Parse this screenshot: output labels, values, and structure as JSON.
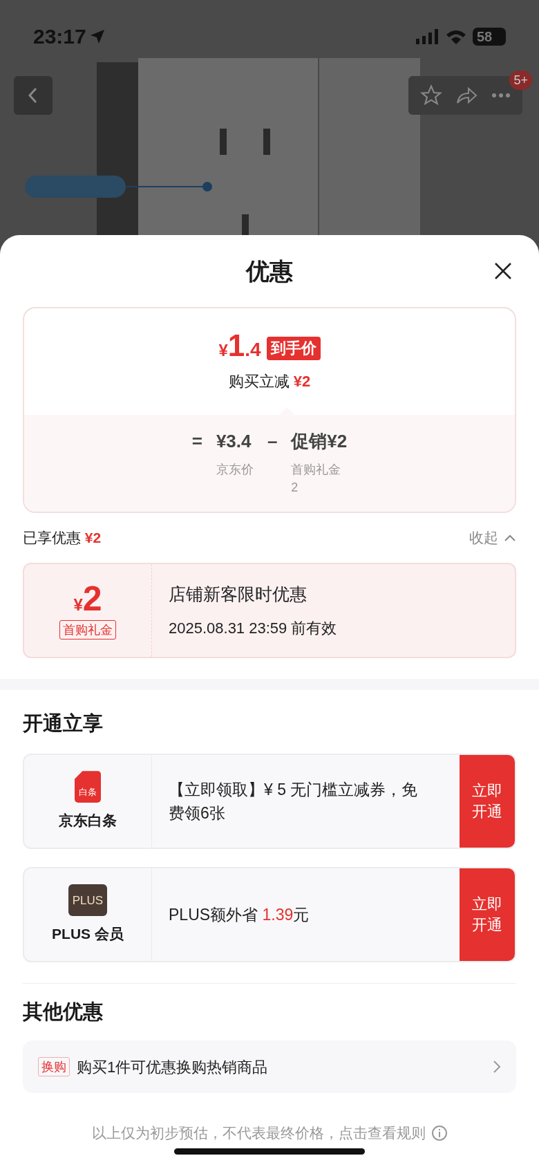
{
  "status_bar": {
    "time": "23:17",
    "battery": "58"
  },
  "nav": {
    "badge": "5+"
  },
  "sheet": {
    "title": "优惠",
    "summary": {
      "currency": "¥",
      "integer": "1",
      "decimal": ".4",
      "tag": "到手价",
      "reduction_label": "购买立减",
      "reduction_value": "¥2",
      "formula": {
        "equals": "=",
        "base_price": "¥3.4",
        "minus": "–",
        "promo": "促销¥2",
        "base_label": "京东价",
        "promo_label": "首购礼金2"
      }
    },
    "applied": {
      "label": "已享优惠",
      "amount": "¥2",
      "toggle": "收起",
      "expanded": true
    },
    "coupons": [
      {
        "currency": "¥",
        "amount": "2",
        "tag": "首购礼金",
        "title": "店铺新客限时优惠",
        "validity": "2025.08.31 23:59 前有效"
      }
    ],
    "open_section": {
      "heading": "开通立享",
      "offers": [
        {
          "kind": "baitiao",
          "icon_text": "白条",
          "name": "京东白条",
          "desc": [
            {
              "text": "【立即领取】¥ 5 无门槛立减券，免费领6张",
              "highlight": false
            }
          ],
          "button": "立即开通"
        },
        {
          "kind": "plus",
          "icon_text": "PLUS",
          "name": "PLUS 会员",
          "desc": [
            {
              "text": "PLUS额外省 ",
              "highlight": false
            },
            {
              "text": "1.39",
              "highlight": true
            },
            {
              "text": "元",
              "highlight": false
            }
          ],
          "button": "立即开通"
        }
      ]
    },
    "other_section": {
      "heading": "其他优惠",
      "items": [
        {
          "tag": "换购",
          "text": "购买1件可优惠换购热销商品"
        }
      ]
    },
    "footer": "以上仅为初步预估，不代表最终价格，点击查看规则"
  }
}
